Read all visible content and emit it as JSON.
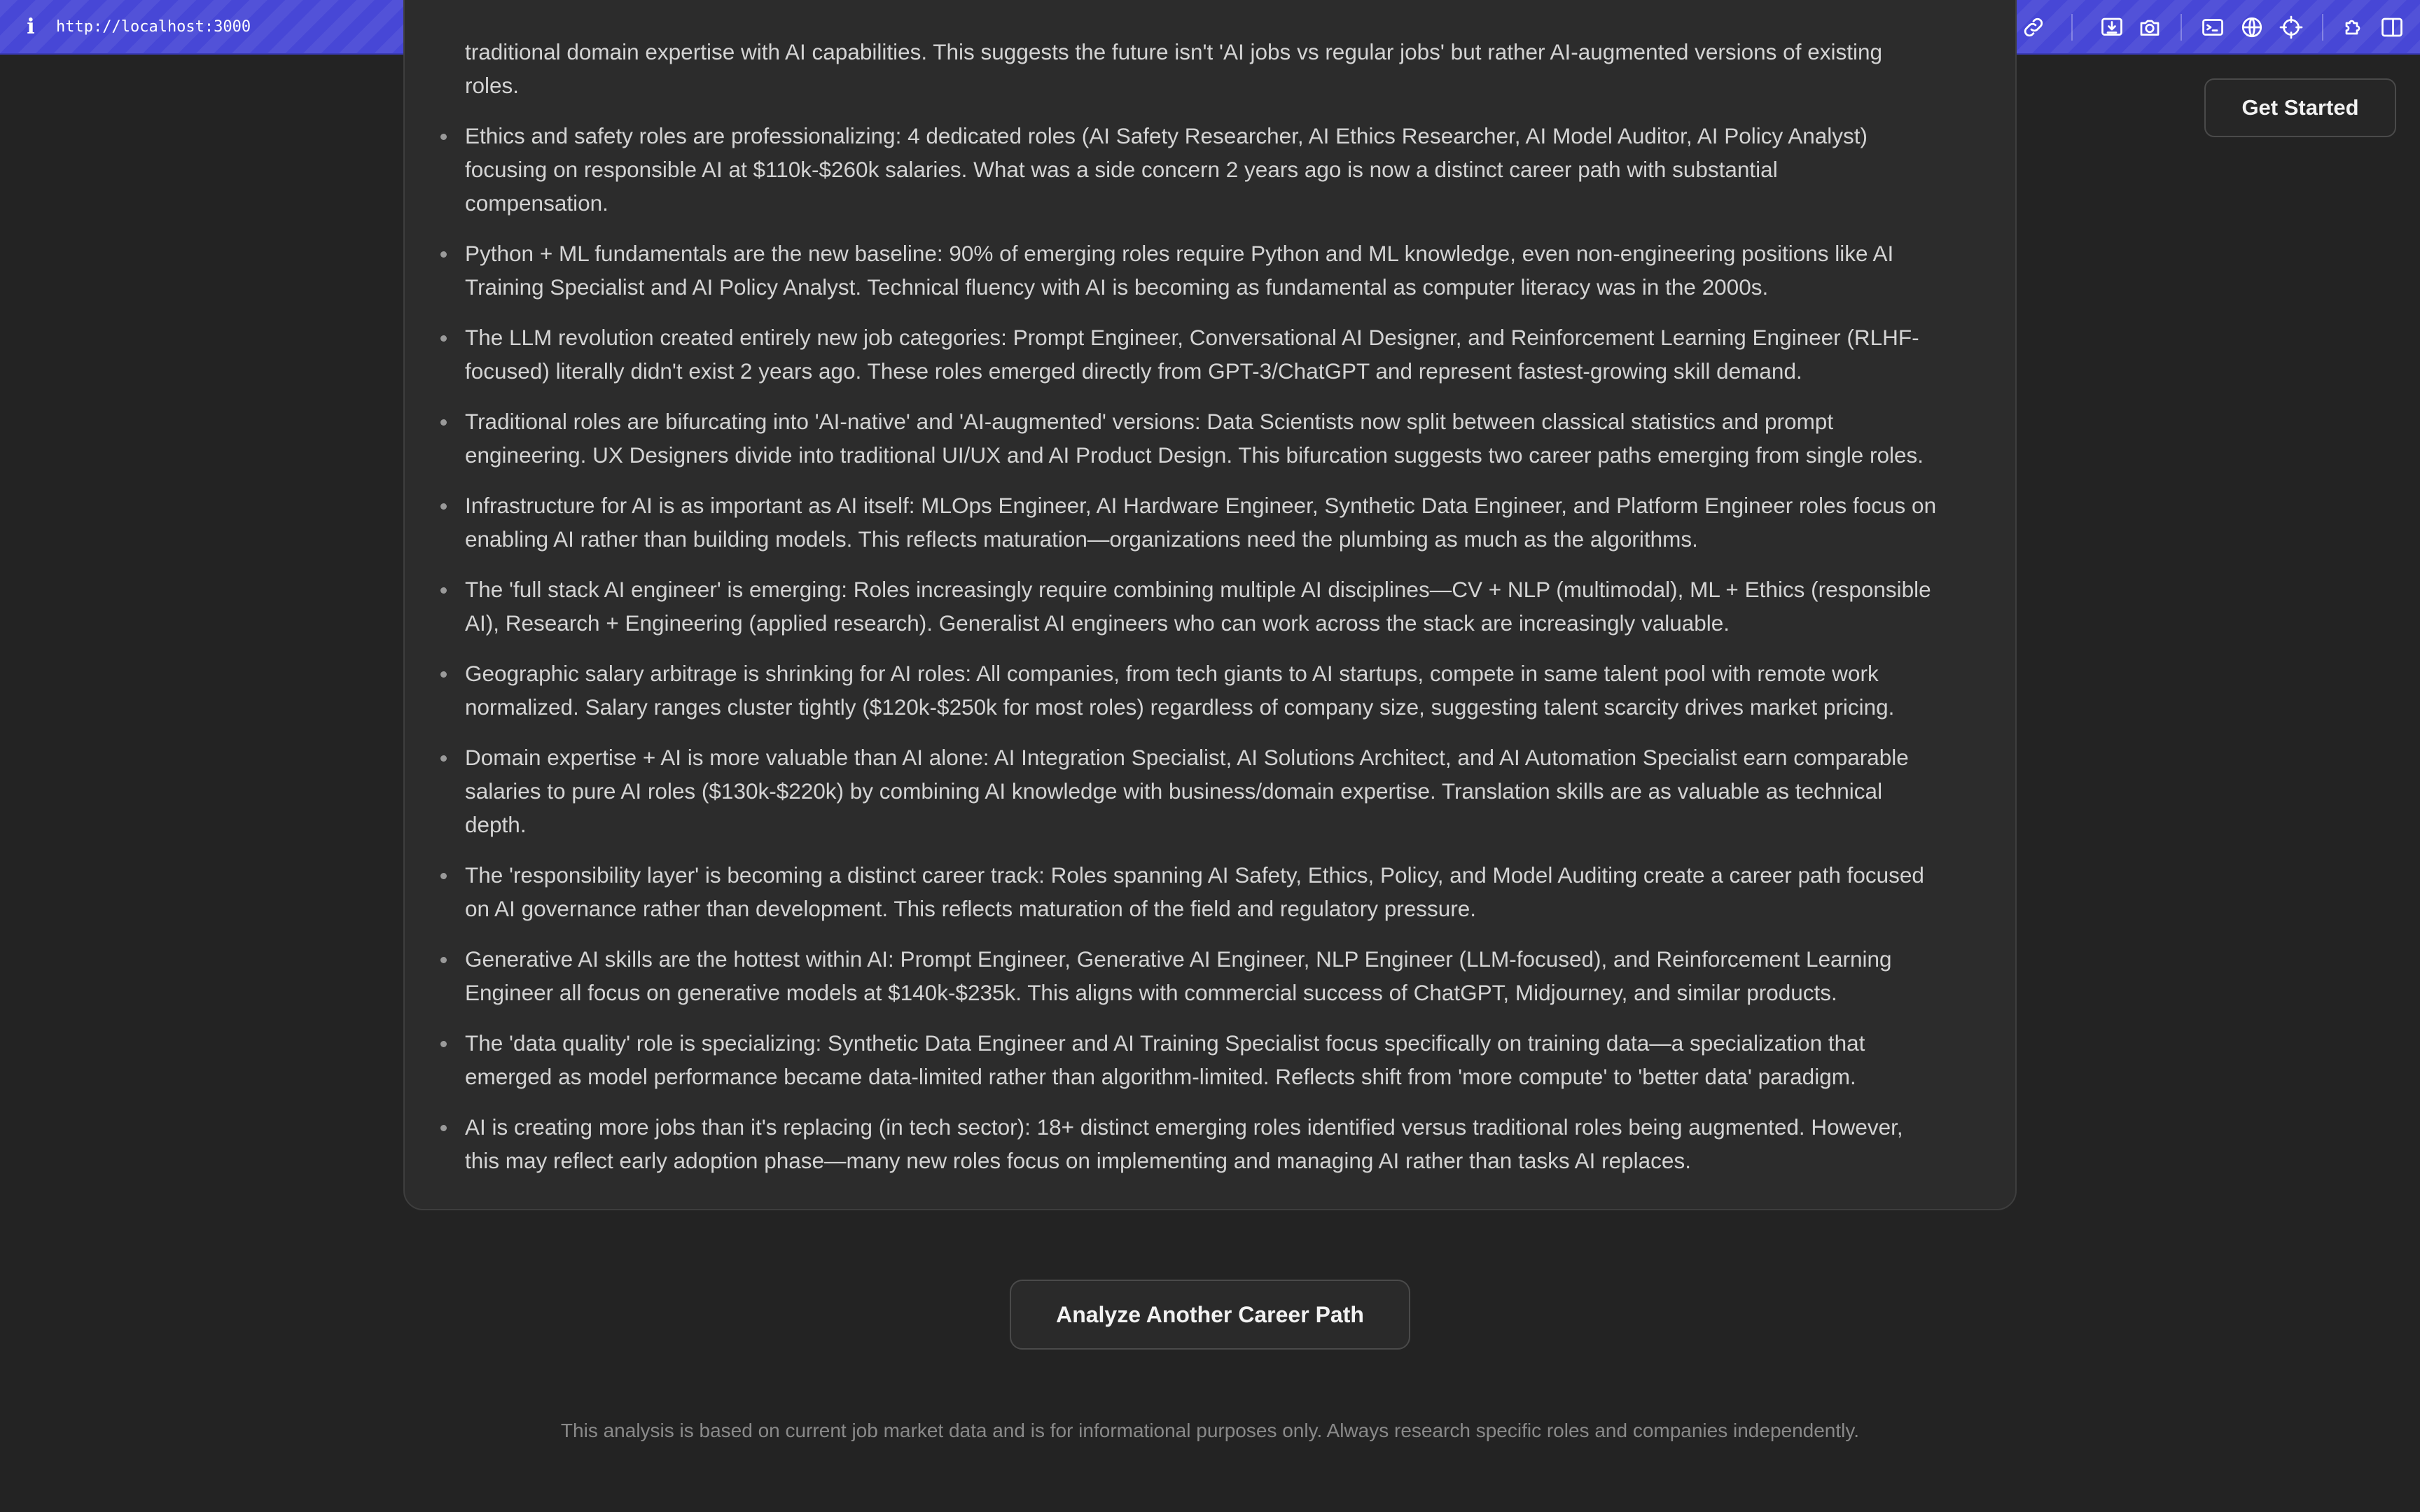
{
  "browser": {
    "url": "http://localhost:3000",
    "icons": [
      "link-icon",
      "download-icon",
      "camera-icon",
      "terminal-icon",
      "globe-icon",
      "crosshair-icon",
      "extension-icon",
      "sidebar-icon"
    ]
  },
  "header": {
    "cta_label": "Get Started"
  },
  "insights": [
    {
      "lines": [
        "traditional domain expertise with AI capabilities. This suggests the future isn't 'AI jobs vs regular jobs' but rather AI-augmented versions of existing",
        "roles."
      ]
    },
    {
      "lines": [
        "Ethics and safety roles are professionalizing: 4 dedicated roles (AI Safety Researcher, AI Ethics Researcher, AI Model Auditor, AI Policy Analyst)",
        "focusing on responsible AI at $110k-$260k salaries. What was a side concern 2 years ago is now a distinct career path with substantial",
        "compensation."
      ]
    },
    {
      "lines": [
        "Python + ML fundamentals are the new baseline: 90% of emerging roles require Python and ML knowledge, even non-engineering positions like AI",
        "Training Specialist and AI Policy Analyst. Technical fluency with AI is becoming as fundamental as computer literacy was in the 2000s."
      ]
    },
    {
      "lines": [
        "The LLM revolution created entirely new job categories: Prompt Engineer, Conversational AI Designer, and Reinforcement Learning Engineer (RLHF-",
        "focused) literally didn't exist 2 years ago. These roles emerged directly from GPT-3/ChatGPT and represent fastest-growing skill demand."
      ]
    },
    {
      "lines": [
        "Traditional roles are bifurcating into 'AI-native' and 'AI-augmented' versions: Data Scientists now split between classical statistics and prompt",
        "engineering. UX Designers divide into traditional UI/UX and AI Product Design. This bifurcation suggests two career paths emerging from single roles."
      ]
    },
    {
      "lines": [
        "Infrastructure for AI is as important as AI itself: MLOps Engineer, AI Hardware Engineer, Synthetic Data Engineer, and Platform Engineer roles focus on",
        "enabling AI rather than building models. This reflects maturation—organizations need the plumbing as much as the algorithms."
      ]
    },
    {
      "lines": [
        "The 'full stack AI engineer' is emerging: Roles increasingly require combining multiple AI disciplines—CV + NLP (multimodal), ML + Ethics (responsible",
        "AI), Research + Engineering (applied research). Generalist AI engineers who can work across the stack are increasingly valuable."
      ]
    },
    {
      "lines": [
        "Geographic salary arbitrage is shrinking for AI roles: All companies, from tech giants to AI startups, compete in same talent pool with remote work",
        "normalized. Salary ranges cluster tightly ($120k-$250k for most roles) regardless of company size, suggesting talent scarcity drives market pricing."
      ]
    },
    {
      "lines": [
        "Domain expertise + AI is more valuable than AI alone: AI Integration Specialist, AI Solutions Architect, and AI Automation Specialist earn comparable",
        "salaries to pure AI roles ($130k-$220k) by combining AI knowledge with business/domain expertise. Translation skills are as valuable as technical",
        "depth."
      ]
    },
    {
      "lines": [
        "The 'responsibility layer' is becoming a distinct career track: Roles spanning AI Safety, Ethics, Policy, and Model Auditing create a career path focused",
        "on AI governance rather than development. This reflects maturation of the field and regulatory pressure."
      ]
    },
    {
      "lines": [
        "Generative AI skills are the hottest within AI: Prompt Engineer, Generative AI Engineer, NLP Engineer (LLM-focused), and Reinforcement Learning",
        "Engineer all focus on generative models at $140k-$235k. This aligns with commercial success of ChatGPT, Midjourney, and similar products."
      ]
    },
    {
      "lines": [
        "The 'data quality' role is specializing: Synthetic Data Engineer and AI Training Specialist focus specifically on training data—a specialization that",
        "emerged as model performance became data-limited rather than algorithm-limited. Reflects shift from 'more compute' to 'better data' paradigm."
      ]
    },
    {
      "lines": [
        "AI is creating more jobs than it's replacing (in tech sector): 18+ distinct emerging roles identified versus traditional roles being augmented. However,",
        "this may reflect early adoption phase—many new roles focus on implementing and managing AI rather than tasks AI replaces."
      ]
    }
  ],
  "actions": {
    "analyze_label": "Analyze Another Career Path"
  },
  "footer": {
    "disclaimer": "This analysis is based on current job market data and is for informational purposes only. Always research specific roles and companies independently."
  }
}
